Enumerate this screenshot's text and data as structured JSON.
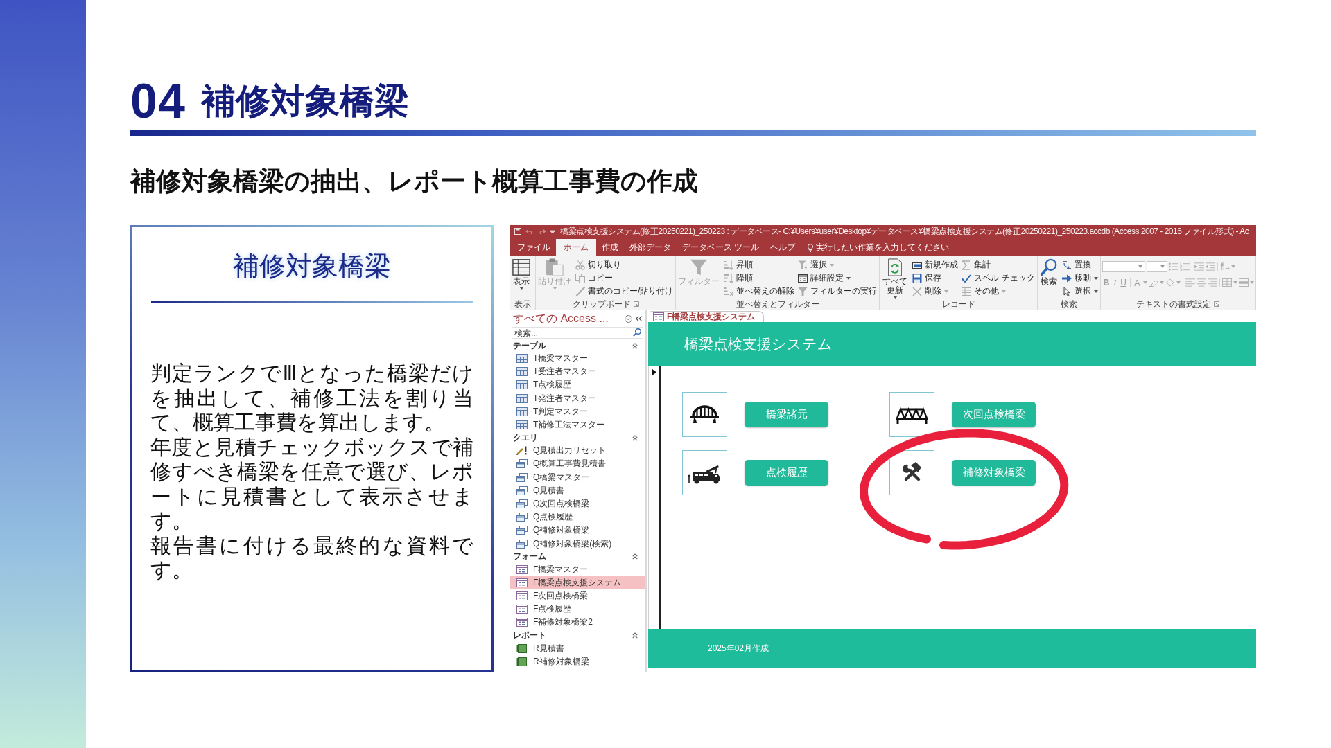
{
  "slide": {
    "number": "04",
    "title": "補修対象橋梁",
    "subtitle": "補修対象橋梁の抽出、レポート概算工事費の作成"
  },
  "card": {
    "title": "補修対象橋梁",
    "paragraphs": [
      "判定ランクでⅢとなった橋梁だけを抽出して、補修工法を割り当て、概算工事費を算出します。",
      "年度と見積チェックボックスで補修すべき橋梁を任意で選び、レポートに見積書として表示させます。",
      "報告書に付ける最終的な資料です。"
    ]
  },
  "access_window": {
    "title": "橋梁点検支援システム(修正20250221)_250223 : データベース- C:¥Users¥user¥Desktop¥データベース¥橋梁点検支援システム(修正20250221)_250223.accdb (Access 2007 - 2016 ファイル形式) - Ac",
    "ribbon_tabs": [
      {
        "label": "ファイル",
        "selected": false
      },
      {
        "label": "ホーム",
        "selected": true
      },
      {
        "label": "作成",
        "selected": false
      },
      {
        "label": "外部データ",
        "selected": false
      },
      {
        "label": "データベース ツール",
        "selected": false
      },
      {
        "label": "ヘルプ",
        "selected": false
      }
    ],
    "tell_me": "実行したい作業を入力してください",
    "ribbon_groups": [
      {
        "kind": "commands",
        "label": "表示",
        "items": [
          {
            "kind": "large",
            "label": "表示",
            "dropdown": true,
            "disabled": false
          }
        ]
      },
      {
        "kind": "commands",
        "label": "クリップボード",
        "launcher": true,
        "items": [
          {
            "kind": "large",
            "label": "貼り付け",
            "dropdown": true,
            "disabled": true
          },
          {
            "kind": "small",
            "label": "切り取り",
            "dropdown": false,
            "disabled": true
          },
          {
            "kind": "small",
            "label": "コピー",
            "dropdown": false,
            "disabled": true
          },
          {
            "kind": "small",
            "label": "書式のコピー/貼り付け",
            "dropdown": false,
            "disabled": true
          }
        ]
      },
      {
        "kind": "commands",
        "label": "並べ替えとフィルター",
        "items": [
          {
            "kind": "large",
            "label": "フィルター",
            "dropdown": false,
            "disabled": true
          },
          {
            "kind": "small",
            "label": "昇順",
            "dropdown": false,
            "disabled": true
          },
          {
            "kind": "small",
            "label": "降順",
            "dropdown": false,
            "disabled": true
          },
          {
            "kind": "small",
            "label": "並べ替えの解除",
            "dropdown": false,
            "disabled": true
          },
          {
            "kind": "small",
            "label": "選択",
            "dropdown": true,
            "disabled": true
          },
          {
            "kind": "small",
            "label": "詳細設定",
            "dropdown": true,
            "disabled": false
          },
          {
            "kind": "small",
            "label": "フィルターの実行",
            "dropdown": false,
            "disabled": true
          }
        ]
      },
      {
        "kind": "commands",
        "label": "レコード",
        "items": [
          {
            "kind": "large",
            "label": "すべて更新",
            "dropdown": true,
            "disabled": false
          },
          {
            "kind": "small",
            "label": "新規作成",
            "dropdown": false,
            "disabled": false
          },
          {
            "kind": "small",
            "label": "保存",
            "dropdown": false,
            "disabled": false
          },
          {
            "kind": "small",
            "label": "削除",
            "dropdown": true,
            "disabled": true
          },
          {
            "kind": "small",
            "label": "集計",
            "dropdown": false,
            "disabled": true
          },
          {
            "kind": "small",
            "label": "スペル チェック",
            "dropdown": false,
            "disabled": false
          },
          {
            "kind": "small",
            "label": "その他",
            "dropdown": true,
            "disabled": true
          }
        ]
      },
      {
        "kind": "commands",
        "label": "検索",
        "items": [
          {
            "kind": "large",
            "label": "検索",
            "dropdown": false,
            "disabled": false
          },
          {
            "kind": "small",
            "label": "置換",
            "dropdown": false,
            "disabled": false
          },
          {
            "kind": "small",
            "label": "移動",
            "dropdown": true,
            "disabled": false
          },
          {
            "kind": "small",
            "label": "選択",
            "dropdown": true,
            "disabled": false
          }
        ]
      },
      {
        "kind": "format",
        "label": "テキストの書式設定",
        "launcher": true,
        "text_buttons": [
          {
            "label": "B",
            "disabled": true
          },
          {
            "label": "I",
            "disabled": true
          },
          {
            "label": "U",
            "disabled": true
          },
          {
            "label": "A",
            "disabled": true
          }
        ]
      }
    ],
    "nav_pane": {
      "title": "すべての Access ...",
      "search_placeholder": "検索...",
      "groups": [
        {
          "label": "テーブル",
          "expanded": true,
          "items": [
            {
              "kind": "table",
              "label": "T橋梁マスター",
              "selected": false
            },
            {
              "kind": "table",
              "label": "T受注者マスター",
              "selected": false
            },
            {
              "kind": "table",
              "label": "T点検履歴",
              "selected": false
            },
            {
              "kind": "table",
              "label": "T発注者マスター",
              "selected": false
            },
            {
              "kind": "table",
              "label": "T判定マスター",
              "selected": false
            },
            {
              "kind": "table",
              "label": "T補修工法マスター",
              "selected": false
            }
          ]
        },
        {
          "label": "クエリ",
          "expanded": true,
          "items": [
            {
              "kind": "action",
              "label": "Q見積出力リセット",
              "selected": false
            },
            {
              "kind": "query",
              "label": "Q概算工事費見積書",
              "selected": false
            },
            {
              "kind": "query",
              "label": "Q橋梁マスター",
              "selected": false
            },
            {
              "kind": "query",
              "label": "Q見積書",
              "selected": false
            },
            {
              "kind": "query",
              "label": "Q次回点検橋梁",
              "selected": false
            },
            {
              "kind": "query",
              "label": "Q点検履歴",
              "selected": false
            },
            {
              "kind": "query",
              "label": "Q補修対象橋梁",
              "selected": false
            },
            {
              "kind": "query",
              "label": "Q補修対象橋梁(検索)",
              "selected": false
            }
          ]
        },
        {
          "label": "フォーム",
          "expanded": true,
          "items": [
            {
              "kind": "form",
              "label": "F橋梁マスター",
              "selected": false
            },
            {
              "kind": "form",
              "label": "F橋梁点検支援システム",
              "selected": true
            },
            {
              "kind": "form",
              "label": "F次回点検橋梁",
              "selected": false
            },
            {
              "kind": "form",
              "label": "F点検履歴",
              "selected": false
            },
            {
              "kind": "form",
              "label": "F補修対象橋梁2",
              "selected": false
            }
          ]
        },
        {
          "label": "レポート",
          "expanded": true,
          "items": [
            {
              "kind": "report",
              "label": "R見積書",
              "selected": false
            },
            {
              "kind": "report",
              "label": "R補修対象橋梁",
              "selected": false
            }
          ]
        }
      ]
    },
    "document_tab": "F橋梁点検支援システム",
    "form": {
      "title": "橋梁点検支援システム",
      "buttons": [
        {
          "label": "橋梁諸元"
        },
        {
          "label": "次回点検橋梁"
        },
        {
          "label": "点検履歴"
        },
        {
          "label": "補修対象橋梁",
          "circled": true
        }
      ],
      "footer": "2025年02月作成"
    }
  }
}
